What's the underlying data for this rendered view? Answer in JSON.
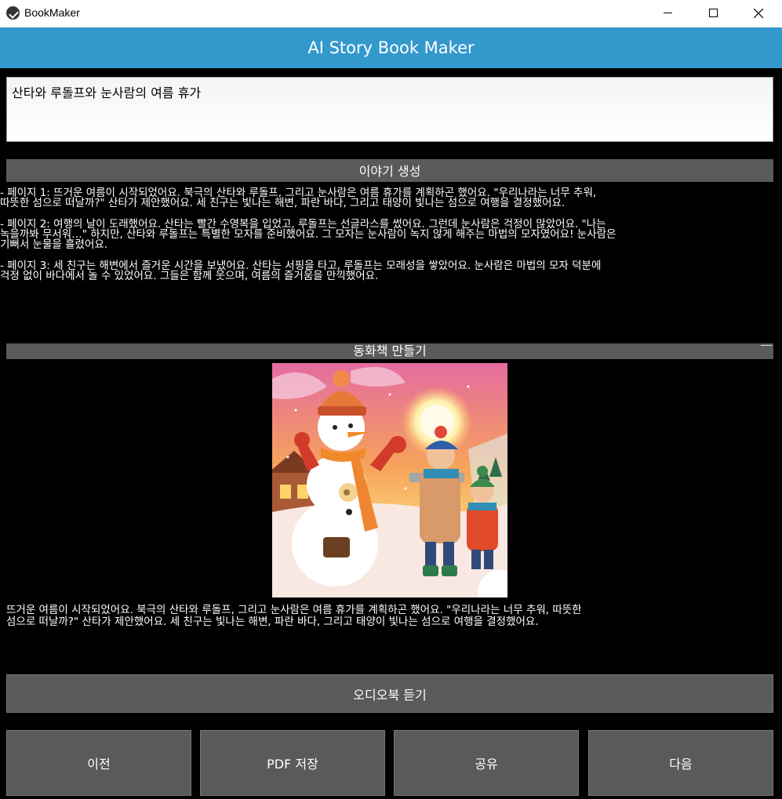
{
  "window": {
    "title": "BookMaker"
  },
  "header": {
    "title": "AI Story Book Maker"
  },
  "prompt": {
    "value": "산타와 루돌프와 눈사람의 여름 휴가"
  },
  "buttons": {
    "generate": "이야기 생성",
    "make_book": "동화책 만들기",
    "audiobook": "오디오북 듣기",
    "prev": "이전",
    "pdf": "PDF 저장",
    "share": "공유",
    "next": "다음"
  },
  "story": {
    "pages": [
      "- 페이지 1: 뜨거운 여름이 시작되었어요. 북극의 산타와 루돌프, 그리고 눈사람은 여름 휴가를 계획하곤 했어요. \"우리나라는 너무 추워,\n따뜻한 섬으로 떠날까?\" 산타가 제안했어요. 세 친구는 빛나는 해변, 파란 바다, 그리고 태양이 빛나는 섬으로 여행을 결정했어요.",
      "- 페이지 2: 여행의 날이 도래했어요. 산타는 빨간 수영복을 입었고, 루돌프는 선글라스를 썼어요. 그런데 눈사람은 걱정이 많았어요. \"나는\n녹을까봐 무서워…\" 하지만, 산타와 루돌프는 특별한 모자를 준비했어요. 그 모자는 눈사람이 녹지 않게 해주는 마법의 모자였어요! 눈사람은\n기뻐서 눈물을 흘렸어요.",
      "- 페이지 3: 세 친구는 해변에서 즐거운 시간을 보냈어요. 산타는 서핑을 타고, 루돌프는 모래성을 쌓았어요. 눈사람은 마법의 모자 덕분에\n걱정 없이 바다에서 놀 수 있었어요. 그들은 함께 웃으며, 여름의 즐거움을 만끽했어요."
    ]
  },
  "book": {
    "caption": "뜨거운 여름이 시작되었어요. 북극의 산타와 루돌프, 그리고 눈사람은 여름 휴가를 계획하곤 했어요. \"우리나라는 너무 추워, 따뜻한\n섬으로 떠날까?\" 산타가 제안했어요. 세 친구는 빛나는 해변, 파란 바다, 그리고 태양이 빛나는 섬으로 여행을 결정했어요."
  },
  "colors": {
    "header_bg": "#3398cc",
    "button_bg": "#5a5a5a",
    "window_bg": "#000000"
  },
  "icons": {
    "app": "bookmaker-app-icon",
    "minimize": "minimize-icon",
    "maximize": "maximize-icon",
    "close": "close-icon"
  }
}
